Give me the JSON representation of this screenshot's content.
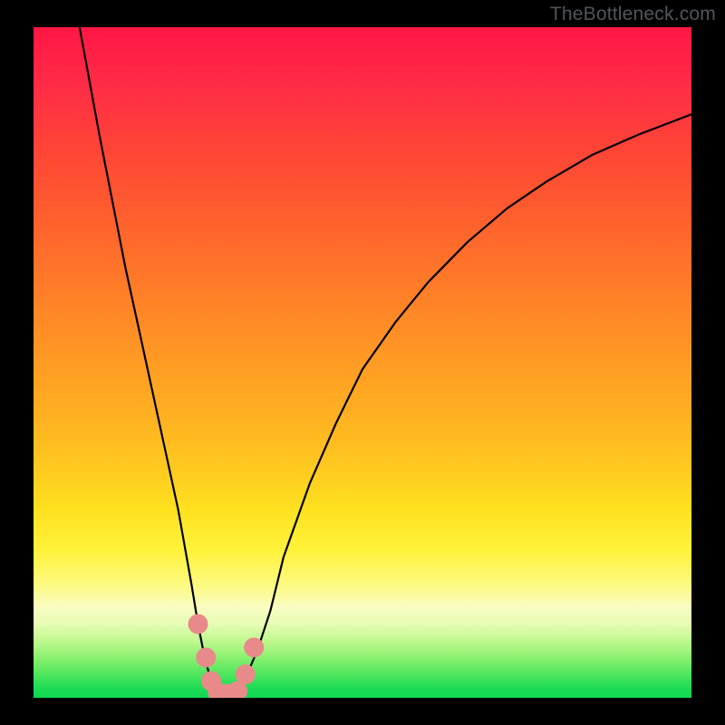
{
  "watermark": "TheBottleneck.com",
  "chart_data": {
    "type": "line",
    "title": "",
    "xlabel": "",
    "ylabel": "",
    "xlim": [
      0,
      100
    ],
    "ylim": [
      0,
      100
    ],
    "series": [
      {
        "name": "curve",
        "x": [
          7,
          10,
          12,
          14,
          16,
          18,
          20,
          22,
          24,
          25,
          26,
          27,
          28,
          29,
          30,
          31,
          32,
          34,
          36,
          38,
          42,
          46,
          50,
          55,
          60,
          66,
          72,
          78,
          85,
          92,
          100
        ],
        "y": [
          100,
          84,
          74,
          64,
          55,
          46,
          37,
          28,
          17,
          11,
          6,
          2.5,
          1,
          0.5,
          0.5,
          1,
          2.5,
          7,
          13,
          21,
          32,
          41,
          49,
          56,
          62,
          68,
          73,
          77,
          81,
          84,
          87
        ]
      }
    ],
    "markers": [
      {
        "x": 25.0,
        "y": 11.0
      },
      {
        "x": 26.2,
        "y": 6.0
      },
      {
        "x": 27.0,
        "y": 2.5
      },
      {
        "x": 28.0,
        "y": 0.8
      },
      {
        "x": 29.5,
        "y": 0.6
      },
      {
        "x": 31.0,
        "y": 1.0
      },
      {
        "x": 32.2,
        "y": 3.5
      },
      {
        "x": 33.5,
        "y": 7.5
      }
    ],
    "marker_color": "#e98a8a",
    "curve_color": "#000000"
  }
}
